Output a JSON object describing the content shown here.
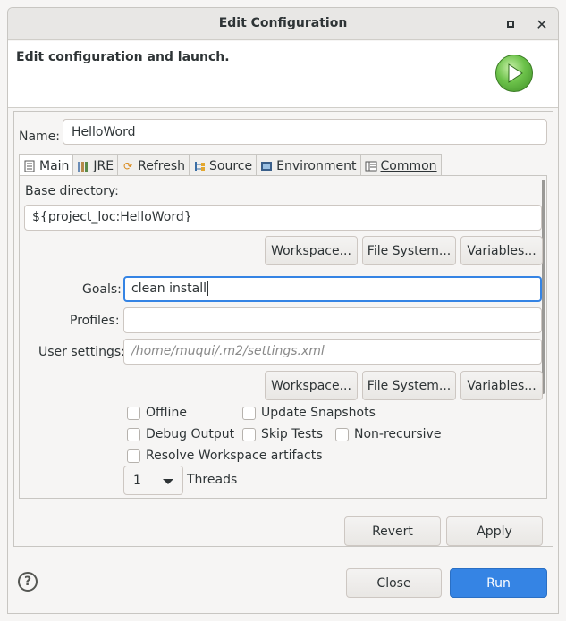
{
  "window": {
    "title": "Edit Configuration"
  },
  "banner": {
    "heading": "Edit configuration and launch."
  },
  "name_field": {
    "label": "Name:",
    "value": "HelloWord"
  },
  "tabs": [
    {
      "label": "Main",
      "icon": "document-icon",
      "active": true
    },
    {
      "label": "JRE",
      "icon": "jre-library-icon"
    },
    {
      "label": "Refresh",
      "icon": "refresh-icon"
    },
    {
      "label": "Source",
      "icon": "source-icon"
    },
    {
      "label": "Environment",
      "icon": "environment-icon"
    },
    {
      "label": "Common",
      "icon": "common-icon"
    }
  ],
  "main_tab": {
    "base_directory": {
      "label": "Base directory:",
      "value": "${project_loc:HelloWord}",
      "buttons": [
        "Workspace...",
        "File System...",
        "Variables..."
      ]
    },
    "goals": {
      "label": "Goals:",
      "value": "clean install"
    },
    "profiles": {
      "label": "Profiles:",
      "value": ""
    },
    "user_settings": {
      "label": "User settings:",
      "placeholder": "/home/muqui/.m2/settings.xml",
      "buttons": [
        "Workspace...",
        "File System...",
        "Variables..."
      ]
    },
    "checkboxes": {
      "offline": "Offline",
      "update_snapshots": "Update Snapshots",
      "debug_output": "Debug Output",
      "skip_tests": "Skip Tests",
      "non_recursive": "Non-recursive",
      "resolve_workspace": "Resolve Workspace artifacts"
    },
    "threads": {
      "value": "1",
      "label": "Threads"
    }
  },
  "panel_buttons": {
    "revert": "Revert",
    "apply": "Apply"
  },
  "footer": {
    "close": "Close",
    "run": "Run"
  },
  "colors": {
    "accent": "#3584e4",
    "run_icon": "#6cc24a"
  }
}
